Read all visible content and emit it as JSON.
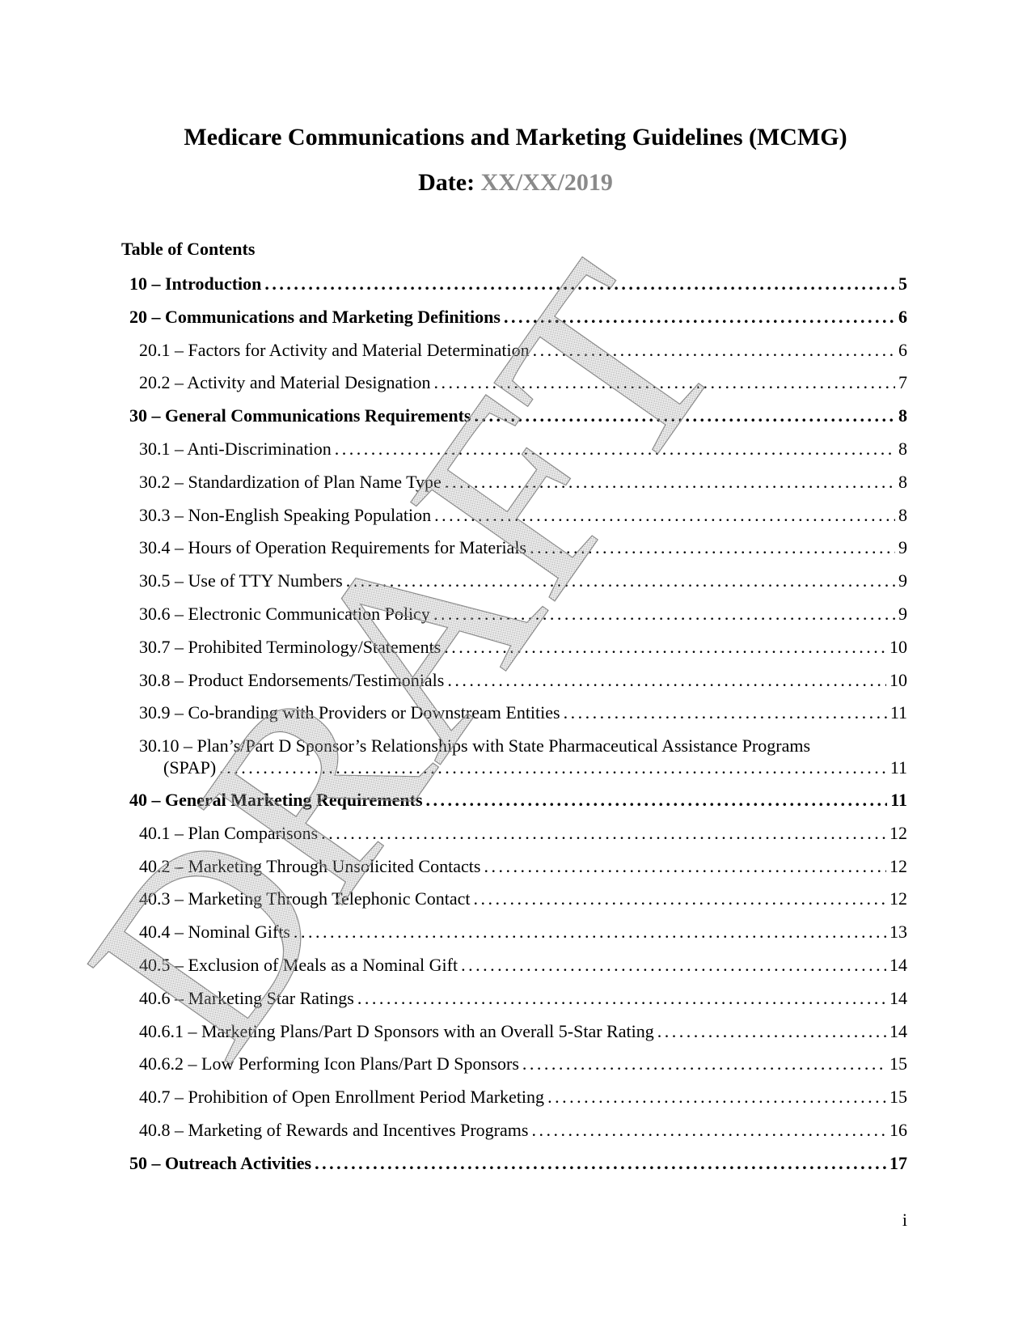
{
  "document": {
    "title": "Medicare Communications and Marketing Guidelines (MCMG)",
    "date_label": "Date:",
    "date_value": "XX/XX/2019",
    "toc_heading": "Table of Contents",
    "watermark": "DRAFT",
    "page_footer": "i"
  },
  "toc": [
    {
      "level": 1,
      "label": "10 – Introduction",
      "page": "5"
    },
    {
      "level": 1,
      "label": "20 – Communications and Marketing Definitions",
      "page": "6"
    },
    {
      "level": 2,
      "label": "20.1 – Factors for Activity and Material Determination",
      "page": "6"
    },
    {
      "level": 2,
      "label": "20.2 – Activity and Material Designation",
      "page": "7"
    },
    {
      "level": 1,
      "label": "30 – General Communications Requirements",
      "page": "8"
    },
    {
      "level": 2,
      "label": "30.1 – Anti-Discrimination",
      "page": "8"
    },
    {
      "level": 2,
      "label": "30.2 – Standardization of Plan Name Type",
      "page": "8"
    },
    {
      "level": 2,
      "label": "30.3 – Non-English Speaking Population",
      "page": "8"
    },
    {
      "level": 2,
      "label": "30.4 – Hours of Operation Requirements for Materials",
      "page": "9"
    },
    {
      "level": 2,
      "label": "30.5 – Use of TTY Numbers",
      "page": "9"
    },
    {
      "level": 2,
      "label": "30.6 – Electronic Communication Policy",
      "page": "9"
    },
    {
      "level": 2,
      "label": "30.7 – Prohibited Terminology/Statements",
      "page": "10"
    },
    {
      "level": 2,
      "label": "30.8 – Product Endorsements/Testimonials",
      "page": "10"
    },
    {
      "level": 2,
      "label": "30.9 – Co-branding with Providers or Downstream Entities",
      "page": "11"
    },
    {
      "level": 2,
      "label": "30.10 – Plan’s/Part D Sponsor’s Relationships with State Pharmaceutical Assistance Programs",
      "label_cont": "(SPAP)",
      "page": "11"
    },
    {
      "level": 1,
      "label": "40 – General Marketing Requirements",
      "page": "11"
    },
    {
      "level": 2,
      "label": "40.1 – Plan Comparisons",
      "page": "12"
    },
    {
      "level": 2,
      "label": "40.2 – Marketing Through Unsolicited Contacts",
      "page": "12"
    },
    {
      "level": 2,
      "label": "40.3 – Marketing Through Telephonic Contact",
      "page": "12"
    },
    {
      "level": 2,
      "label": "40.4 – Nominal Gifts",
      "page": "13"
    },
    {
      "level": 2,
      "label": "40.5 – Exclusion of Meals as a Nominal Gift",
      "page": "14"
    },
    {
      "level": 2,
      "label": "40.6 – Marketing Star Ratings",
      "page": "14"
    },
    {
      "level": 2,
      "label": "40.6.1 – Marketing Plans/Part D Sponsors with an Overall 5-Star Rating",
      "page": "14"
    },
    {
      "level": 2,
      "label": "40.6.2 – Low Performing Icon Plans/Part D Sponsors",
      "page": "15"
    },
    {
      "level": 2,
      "label": "40.7 – Prohibition of Open Enrollment Period Marketing",
      "page": "15"
    },
    {
      "level": 2,
      "label": "40.8 – Marketing of Rewards and Incentives Programs",
      "page": "16"
    },
    {
      "level": 1,
      "label": "50 – Outreach Activities",
      "page": "17"
    }
  ]
}
